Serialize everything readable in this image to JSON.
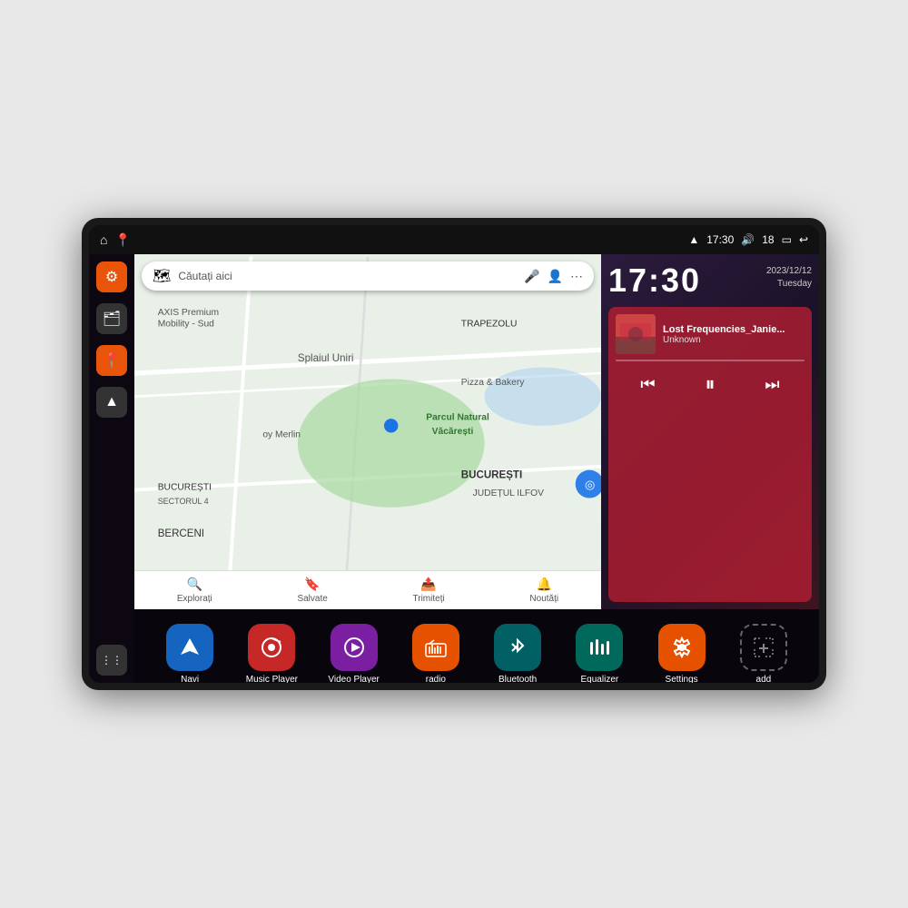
{
  "device": {
    "status_bar": {
      "wifi_icon": "▲",
      "time": "17:30",
      "volume_icon": "🔊",
      "battery_num": "18",
      "battery_icon": "🔋",
      "back_icon": "↩"
    },
    "sidebar": {
      "buttons": [
        {
          "id": "settings",
          "icon": "⚙",
          "color": "orange"
        },
        {
          "id": "files",
          "icon": "🗂",
          "color": "dark"
        },
        {
          "id": "maps",
          "icon": "📍",
          "color": "orange"
        },
        {
          "id": "nav",
          "icon": "▲",
          "color": "dark"
        }
      ],
      "bottom": {
        "id": "grid",
        "icon": "⋮⋮⋮",
        "color": "dark"
      }
    },
    "map": {
      "search_placeholder": "Căutați aici",
      "location_label": "Parcul Natural Văcărești",
      "bottom_items": [
        {
          "label": "Explorați",
          "icon": "🔍"
        },
        {
          "label": "Salvate",
          "icon": "🔖"
        },
        {
          "label": "Trimiteți",
          "icon": "📤"
        },
        {
          "label": "Noutăți",
          "icon": "🔔"
        }
      ]
    },
    "clock": {
      "time": "17:30",
      "date": "2023/12/12",
      "day": "Tuesday"
    },
    "music": {
      "title": "Lost Frequencies_Janie...",
      "artist": "Unknown",
      "progress": 0
    },
    "apps": [
      {
        "id": "navi",
        "label": "Navi",
        "icon": "▲",
        "color": "blue"
      },
      {
        "id": "music-player",
        "label": "Music Player",
        "icon": "♪",
        "color": "red"
      },
      {
        "id": "video-player",
        "label": "Video Player",
        "icon": "▶",
        "color": "purple-red"
      },
      {
        "id": "radio",
        "label": "radio",
        "icon": "📻",
        "color": "orange"
      },
      {
        "id": "bluetooth",
        "label": "Bluetooth",
        "icon": "₿",
        "color": "cyan"
      },
      {
        "id": "equalizer",
        "label": "Equalizer",
        "icon": "≡",
        "color": "teal"
      },
      {
        "id": "settings",
        "label": "Settings",
        "icon": "⚙",
        "color": "orange2"
      },
      {
        "id": "add",
        "label": "add",
        "icon": "+",
        "color": "gray"
      }
    ]
  }
}
